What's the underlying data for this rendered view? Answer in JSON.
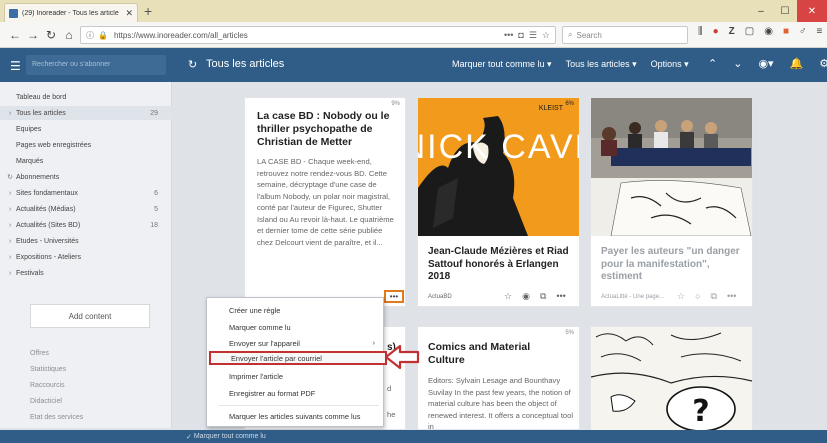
{
  "browser": {
    "tab_title": "(29) Inoreader - Tous les article",
    "tab_close": "✕",
    "new_tab": "+",
    "url": "https://www.inoreader.com/all_articles",
    "search_placeholder": "Search",
    "url_dots": "•••"
  },
  "header": {
    "search_placeholder": "Rechercher ou s'abonner",
    "title": "Tous les articles",
    "mark_all": "Marquer tout comme lu",
    "all_articles": "Tous les articles",
    "options": "Options"
  },
  "sidebar": {
    "items": [
      {
        "label": "Tableau de bord",
        "count": ""
      },
      {
        "label": "Tous les articles",
        "count": "29"
      },
      {
        "label": "Equipes",
        "count": ""
      },
      {
        "label": "Pages web enregistrées",
        "count": ""
      },
      {
        "label": "Marqués",
        "count": ""
      },
      {
        "label": "Abonnements",
        "count": ""
      },
      {
        "label": "Sites fondamentaux",
        "count": "6"
      },
      {
        "label": "Actualités (Médias)",
        "count": "5"
      },
      {
        "label": "Actualités (Sites BD)",
        "count": "18"
      },
      {
        "label": "Etudes - Universités",
        "count": ""
      },
      {
        "label": "Expositions - Ateliers",
        "count": ""
      },
      {
        "label": "Festivals",
        "count": ""
      }
    ],
    "add_content": "Add content",
    "footer": [
      "Offres",
      "Statistiques",
      "Raccourcis",
      "Didacticiel",
      "Etat des services"
    ]
  },
  "cards": [
    {
      "title": "La case BD : Nobody ou le thriller psychopathe de Christian de Metter",
      "body": "LA CASE BD - Chaque week-end, retrouvez notre rendez-vous BD. Cette semaine, décryptage d'une case de l'album Nobody, un polar noir magistral, conté par l'auteur de Figurec, Shutter Island ou Au revoir là-haut. Le quatrième et dernier tome de cette série publiée chez Delcourt vient de paraître, et il...",
      "pct": "9%"
    },
    {
      "title": "Jean-Claude Mézières et Riad Sattouf honorés à Erlangen 2018",
      "meta": "ActuaBD",
      "image_text": "NICK CAVE",
      "image_label": "KLEIST",
      "pct": "6%"
    },
    {
      "title": "Payer les auteurs \"un danger pour la manifestation\", estiment",
      "meta": "ActuaLitté - Une page...",
      "pct": ""
    },
    {
      "title": "Comics and Material Culture",
      "body": "Editors: Sylvain Lesage and Bounthavy Suvilay In the past few years, the notion of material culture has been the object of renewed interest. It offers a conceptual tool in",
      "pct": "5%"
    }
  ],
  "partial_texts": {
    "card5_fragment": "s)",
    "card5_d": "d",
    "card5_he": "he"
  },
  "context_menu": {
    "items": [
      "Créer une règle",
      "Marquer comme lu",
      "Envoyer sur l'appareil",
      "Envoyer l'article par courriel",
      "Imprimer l'article",
      "Enregistrer au format PDF",
      "Marquer les articles suivants comme lus"
    ],
    "submenu_arrow": "›",
    "bottom_fragment": "auteur is this complex issue trend fro"
  },
  "more_button": "•••",
  "statusbar": "Marquer tout comme lu",
  "colors": {
    "header": "#2f5d87",
    "highlight_red": "#c23131",
    "highlight_orange": "#e07a1c",
    "nick_cave_bg": "#f29a1c"
  }
}
